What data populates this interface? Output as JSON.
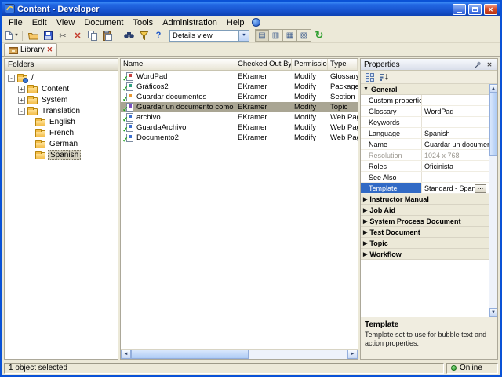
{
  "colors": {
    "titlebar_blue": "#1753CE",
    "window_frame": "#0A52D6",
    "face": "#ECE9D8",
    "selection_blue": "#316AC5",
    "inactive_selection": "#A9A593",
    "online_green": "#2E9E2E",
    "delete_red": "#C43C2C"
  },
  "window": {
    "title": "Content - Developer"
  },
  "menu": {
    "items": [
      {
        "label": "File"
      },
      {
        "label": "Edit"
      },
      {
        "label": "View"
      },
      {
        "label": "Document"
      },
      {
        "label": "Tools"
      },
      {
        "label": "Administration"
      },
      {
        "label": "Help"
      }
    ]
  },
  "toolbar": {
    "view_select": "Details view"
  },
  "tab": {
    "label": "Library"
  },
  "folders": {
    "title": "Folders",
    "items": [
      {
        "label": "/",
        "expander": "-"
      },
      {
        "label": "Content",
        "expander": "+"
      },
      {
        "label": "System",
        "expander": "+"
      },
      {
        "label": "Translation",
        "expander": "-"
      },
      {
        "label": "English",
        "expander": ""
      },
      {
        "label": "French",
        "expander": ""
      },
      {
        "label": "German",
        "expander": ""
      },
      {
        "label": "Spanish",
        "expander": ""
      }
    ]
  },
  "files": {
    "columns": [
      {
        "label": "Name"
      },
      {
        "label": "Checked Out By"
      },
      {
        "label": "Permission"
      },
      {
        "label": "Type"
      }
    ],
    "rows": [
      {
        "name": "WordPad",
        "checked_out_by": "EKramer",
        "permission": "Modify",
        "type": "Glossary"
      },
      {
        "name": "Gráficos2",
        "checked_out_by": "EKramer",
        "permission": "Modify",
        "type": "Package"
      },
      {
        "name": "Guardar documentos",
        "checked_out_by": "EKramer",
        "permission": "Modify",
        "type": "Section"
      },
      {
        "name": "Guardar un documento como archivo nuevo",
        "checked_out_by": "EKramer",
        "permission": "Modify",
        "type": "Topic"
      },
      {
        "name": "archivo",
        "checked_out_by": "EKramer",
        "permission": "Modify",
        "type": "Web Page"
      },
      {
        "name": "GuardaArchivo",
        "checked_out_by": "EKramer",
        "permission": "Modify",
        "type": "Web Page"
      },
      {
        "name": "Documento2",
        "checked_out_by": "EKramer",
        "permission": "Modify",
        "type": "Web Page"
      }
    ]
  },
  "properties": {
    "title": "Properties",
    "general": {
      "label": "General"
    },
    "fields": [
      {
        "label": "Custom properties",
        "value": ""
      },
      {
        "label": "Glossary",
        "value": "WordPad"
      },
      {
        "label": "Keywords",
        "value": ""
      },
      {
        "label": "Language",
        "value": "Spanish"
      },
      {
        "label": "Name",
        "value": "Guardar un documento com..."
      },
      {
        "label": "Resolution",
        "value": "1024 x 768"
      },
      {
        "label": "Roles",
        "value": "Oficinista"
      },
      {
        "label": "See Also",
        "value": ""
      },
      {
        "label": "Template",
        "value": "Standard - Spanish"
      }
    ],
    "categories": [
      {
        "label": "Instructor Manual"
      },
      {
        "label": "Job Aid"
      },
      {
        "label": "System Process Document"
      },
      {
        "label": "Test Document"
      },
      {
        "label": "Topic"
      },
      {
        "label": "Workflow"
      }
    ],
    "description": {
      "title": "Template",
      "text": "Template set to use for bubble text and action properties."
    }
  },
  "status": {
    "left": "1 object selected",
    "right": "Online"
  },
  "icons": {
    "dropdown": "▼",
    "cut": "✂",
    "delete": "✕",
    "help": "?",
    "refresh": "↻",
    "close": "✕",
    "tab_close": "✕",
    "details_view": "▤",
    "list_view": "▥",
    "icons_view": "▦",
    "tiles_view": "▧",
    "checkmark": "✓",
    "category_open": "▼",
    "category_closed": "▶",
    "scroll_up": "▲",
    "scroll_down": "▼",
    "scroll_left": "◄",
    "scroll_right": "►",
    "ellipsis": "..."
  }
}
